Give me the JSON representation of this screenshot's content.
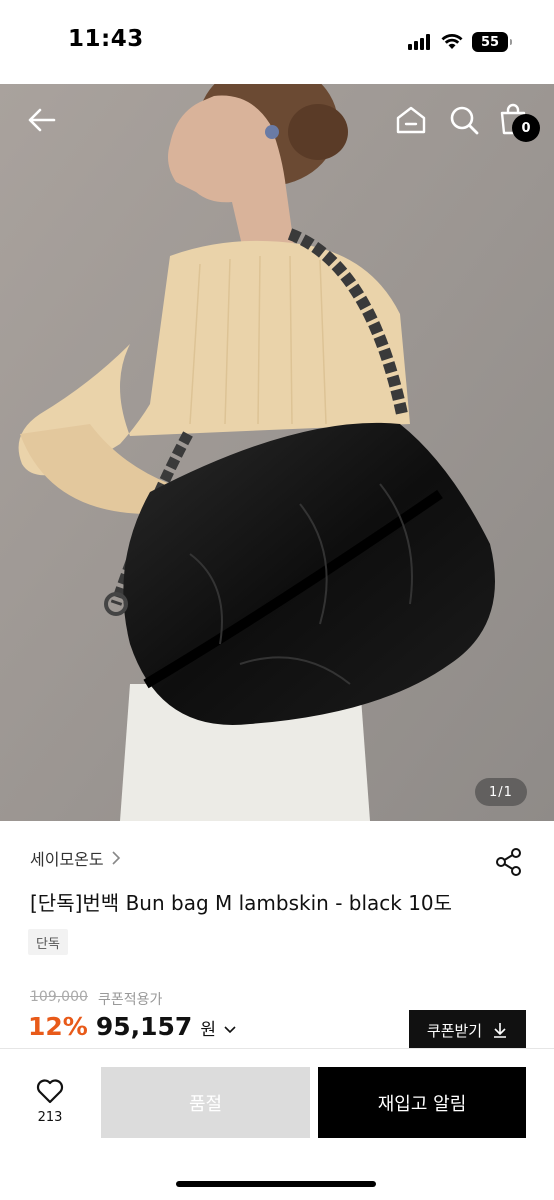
{
  "status_bar": {
    "time": "11:43",
    "battery": "55",
    "icons": [
      "cellular-signal-icon",
      "wifi-icon",
      "battery-icon"
    ]
  },
  "header": {
    "icons": [
      "back-arrow-icon",
      "home-icon",
      "search-icon",
      "shopping-bag-icon"
    ],
    "cart_count": "0"
  },
  "gallery": {
    "page_indicator": "1/1"
  },
  "product": {
    "brand": "세이모온도",
    "title": "[단독]번백 Bun bag M lambskin - black 10도",
    "tag": "단독",
    "original_price": "109,000",
    "coupon_price_label": "쿠폰적용가",
    "discount": "12%",
    "sale_price": "95,157",
    "currency": "원",
    "coupon_button": "쿠폰받기"
  },
  "bottom_bar": {
    "like_count": "213",
    "soldout_label": "품절",
    "restock_label": "재입고 알림"
  },
  "colors": {
    "accent": "#e85a19",
    "primary": "#111111",
    "disabled": "#dcdcdc"
  }
}
